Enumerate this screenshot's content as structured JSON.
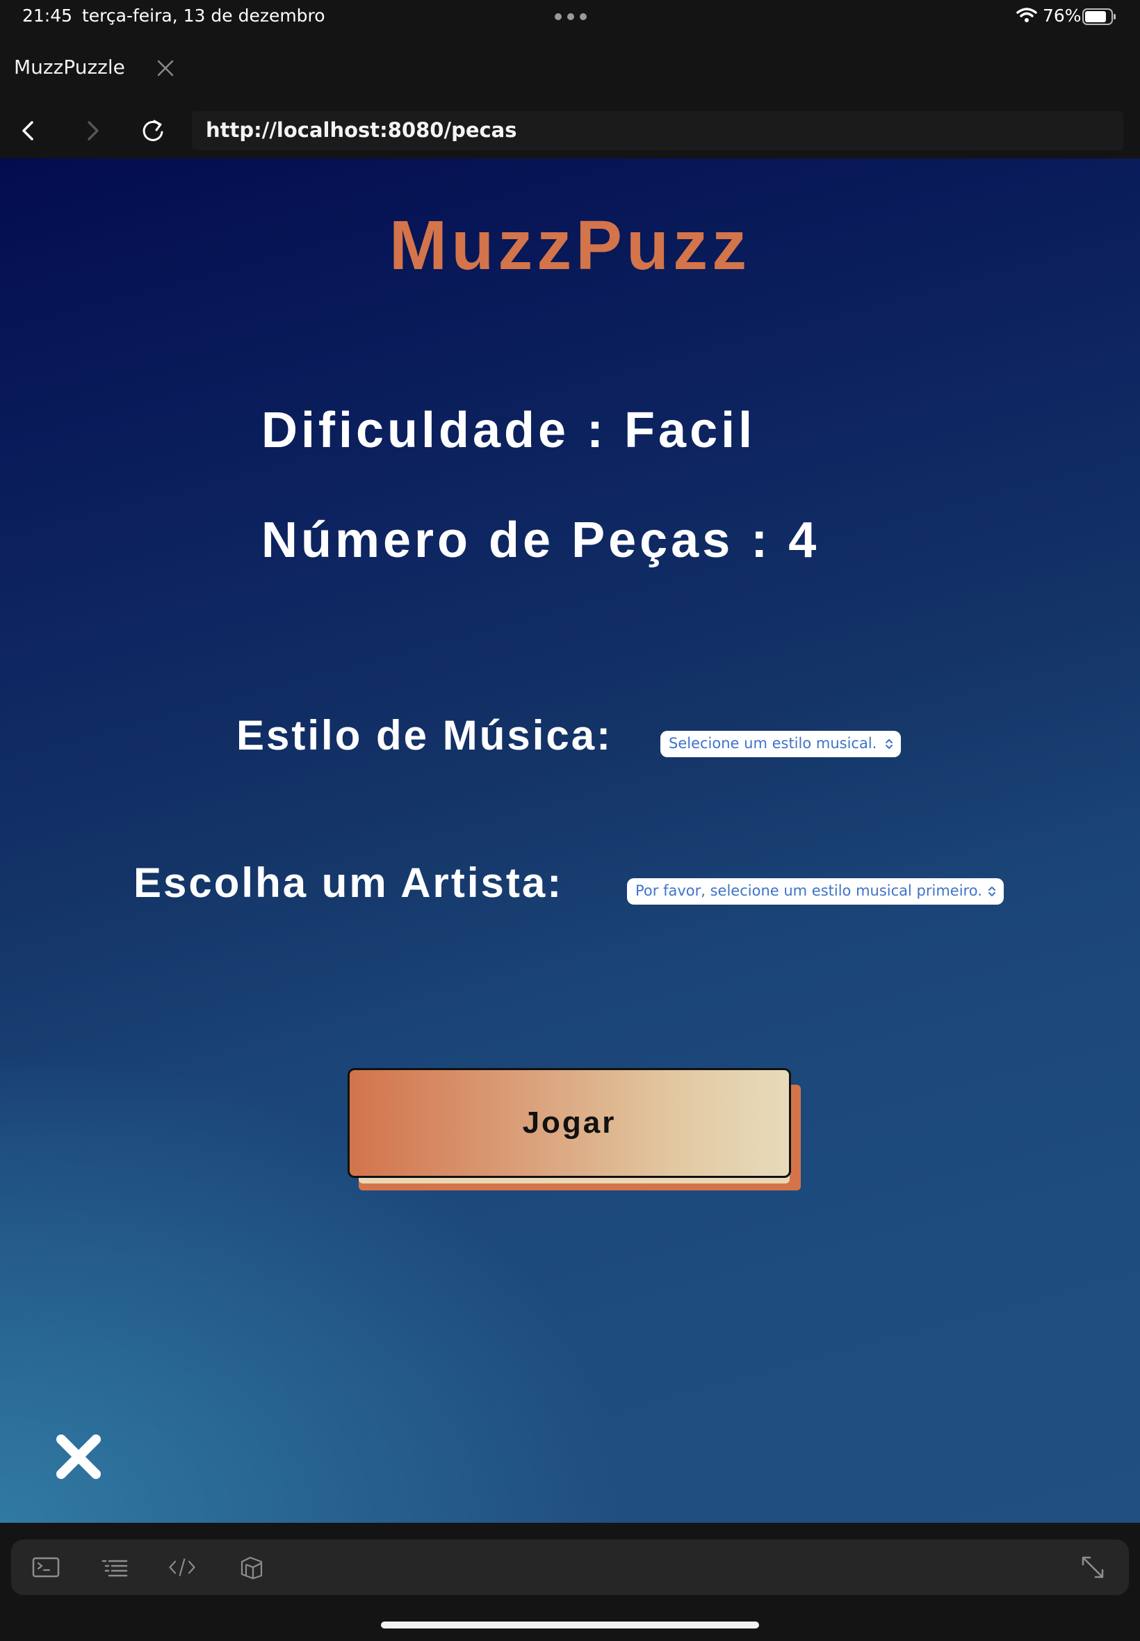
{
  "status_bar": {
    "time": "21:45",
    "date": "terça-feira, 13 de dezembro",
    "battery_percent": "76%",
    "battery_level": 0.76
  },
  "browser": {
    "tab_title": "MuzzPuzzle",
    "url": "http://localhost:8080/pecas"
  },
  "page": {
    "logo": "MuzzPuzz",
    "difficulty": "Dificuldade : Facil",
    "pieces": "Número de Peças : 4",
    "music_style_label": "Estilo de Música:",
    "music_style_select": "Selecione um estilo musical.",
    "artist_label": "Escolha um Artista:",
    "artist_select": "Por favor, selecione um estilo musical primeiro.",
    "play_button": "Jogar"
  },
  "toolbar": {
    "icons": [
      "terminal-icon",
      "list-icon",
      "code-icon",
      "layers-icon",
      "expand-icon"
    ]
  },
  "colors": {
    "logo": "#d4744a",
    "background_top": "#030c4f",
    "background_bottom": "#3482aa",
    "select_text": "#3f73c9",
    "button_gradient_start": "#d2744c",
    "button_gradient_end": "#e7dbbb"
  }
}
